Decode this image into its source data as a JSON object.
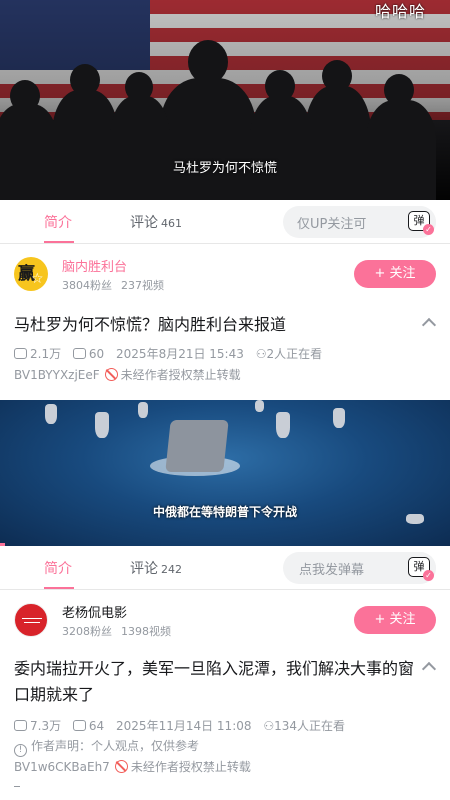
{
  "colors": {
    "accent": "#fb7299",
    "text": "#18191c",
    "muted": "#9499a0",
    "warning": "#f25d59"
  },
  "posts": [
    {
      "player": {
        "top_tag": "哈哈哈",
        "subtitle": "马杜罗为何不惊慌"
      },
      "tabs": {
        "intro": "简介",
        "comments": "评论",
        "comment_count": "461"
      },
      "danmaku": {
        "placeholder": "仅UP关注可",
        "icon_text": "弹",
        "icon_name": "danmaku-toggle-icon"
      },
      "uploader": {
        "name": "脑内胜利台",
        "fans": "3804粉丝",
        "videos": "237视频",
        "follow_label": "+ 关注",
        "avatar_text": "赢"
      },
      "title": "马杜罗为何不惊慌？脑内胜利台来报道",
      "stats": {
        "plays": "2.1万",
        "danmaku_count": "60",
        "date": "2025年8月21日 15:43",
        "watching": "2人正在看"
      },
      "bvid": "BV1BYYXzjEeF",
      "copyright": "未经作者授权禁止转载"
    },
    {
      "player": {
        "subtitle": "中俄都在等特朗普下令开战"
      },
      "tabs": {
        "intro": "简介",
        "comments": "评论",
        "comment_count": "242"
      },
      "danmaku": {
        "placeholder": "点我发弹幕",
        "icon_text": "弹",
        "icon_name": "danmaku-toggle-icon"
      },
      "uploader": {
        "name": "老杨侃电影",
        "fans": "3208粉丝",
        "videos": "1398视频",
        "follow_label": "+ 关注"
      },
      "title": "委内瑞拉开火了，美军一旦陷入泥潭，我们解决大事的窗口期就来了",
      "stats": {
        "plays": "7.3万",
        "danmaku_count": "64",
        "date": "2025年11月14日 11:08",
        "watching": "134人正在看"
      },
      "declaration": "作者声明：个人观点，仅供参考",
      "bvid": "BV1w6CKBaEh7",
      "copyright": "未经作者授权禁止转载"
    }
  ]
}
